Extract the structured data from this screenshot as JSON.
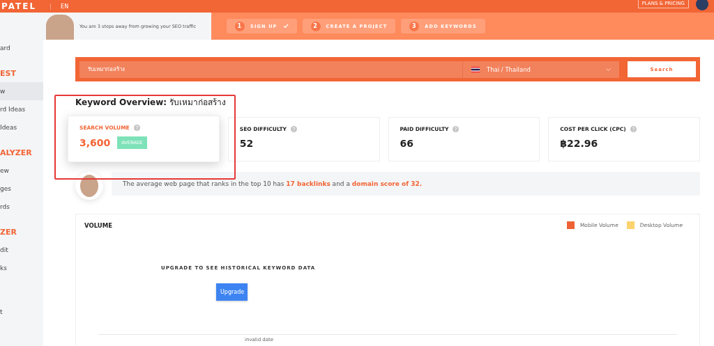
{
  "topbar": {
    "logo": "PATEL",
    "language": "EN",
    "plans_button": "PLANS & PRICING"
  },
  "sidebar": {
    "items": [
      {
        "label": "ard",
        "kind": "item",
        "selected": false
      },
      {
        "label": "EST",
        "kind": "header",
        "selected": false
      },
      {
        "label": "w",
        "kind": "item",
        "selected": true
      },
      {
        "label": "rd Ideas",
        "kind": "item",
        "selected": false
      },
      {
        "label": "Ideas",
        "kind": "item",
        "selected": false
      },
      {
        "label": "ALYZER",
        "kind": "header",
        "selected": false
      },
      {
        "label": "ew",
        "kind": "item",
        "selected": false
      },
      {
        "label": "ges",
        "kind": "item",
        "selected": false
      },
      {
        "label": "rds",
        "kind": "item",
        "selected": false
      },
      {
        "label": "ZER",
        "kind": "header",
        "selected": false
      },
      {
        "label": "dit",
        "kind": "item",
        "selected": false
      },
      {
        "label": "ks",
        "kind": "item",
        "selected": false
      },
      {
        "label": "t",
        "kind": "item",
        "selected": false
      }
    ]
  },
  "onboarding": {
    "message": "You are 3 steps away from growing your SEO traffic",
    "steps": [
      {
        "number": "1",
        "label": "SIGN UP",
        "done": true
      },
      {
        "number": "2",
        "label": "CREATE A PROJECT",
        "done": false
      },
      {
        "number": "3",
        "label": "ADD KEYWORDS",
        "done": false
      }
    ]
  },
  "search": {
    "keyword": "รับเหมาก่อสร้าง",
    "location": "Thai / Thailand",
    "button": "Search"
  },
  "overview": {
    "title": "Keyword Overview:",
    "keyword": "รับเหมาก่อสร้าง"
  },
  "metrics": [
    {
      "label": "SEARCH VOLUME",
      "value": "3,600",
      "badge": "AVERAGE",
      "highlighted": true
    },
    {
      "label": "SEO DIFFICULTY",
      "value": "52",
      "highlighted": false
    },
    {
      "label": "PAID DIFFICULTY",
      "value": "66",
      "highlighted": false
    },
    {
      "label": "COST PER CLICK (CPC)",
      "value": "฿22.96",
      "highlighted": false
    }
  ],
  "tip": "The average web page that ranks in the top 10 has **17 backlinks** and a **domain score of 32.**",
  "volume": {
    "title": "VOLUME",
    "legend": [
      {
        "name": "Mobile Volume",
        "color": "#ee6236"
      },
      {
        "name": "Desktop Volume",
        "color": "#fdd36e"
      }
    ],
    "upgrade_message": "UPGRADE TO SEE HISTORICAL KEYWORD DATA",
    "upgrade_button": "Upgrade",
    "axis_label": "invalid date"
  }
}
